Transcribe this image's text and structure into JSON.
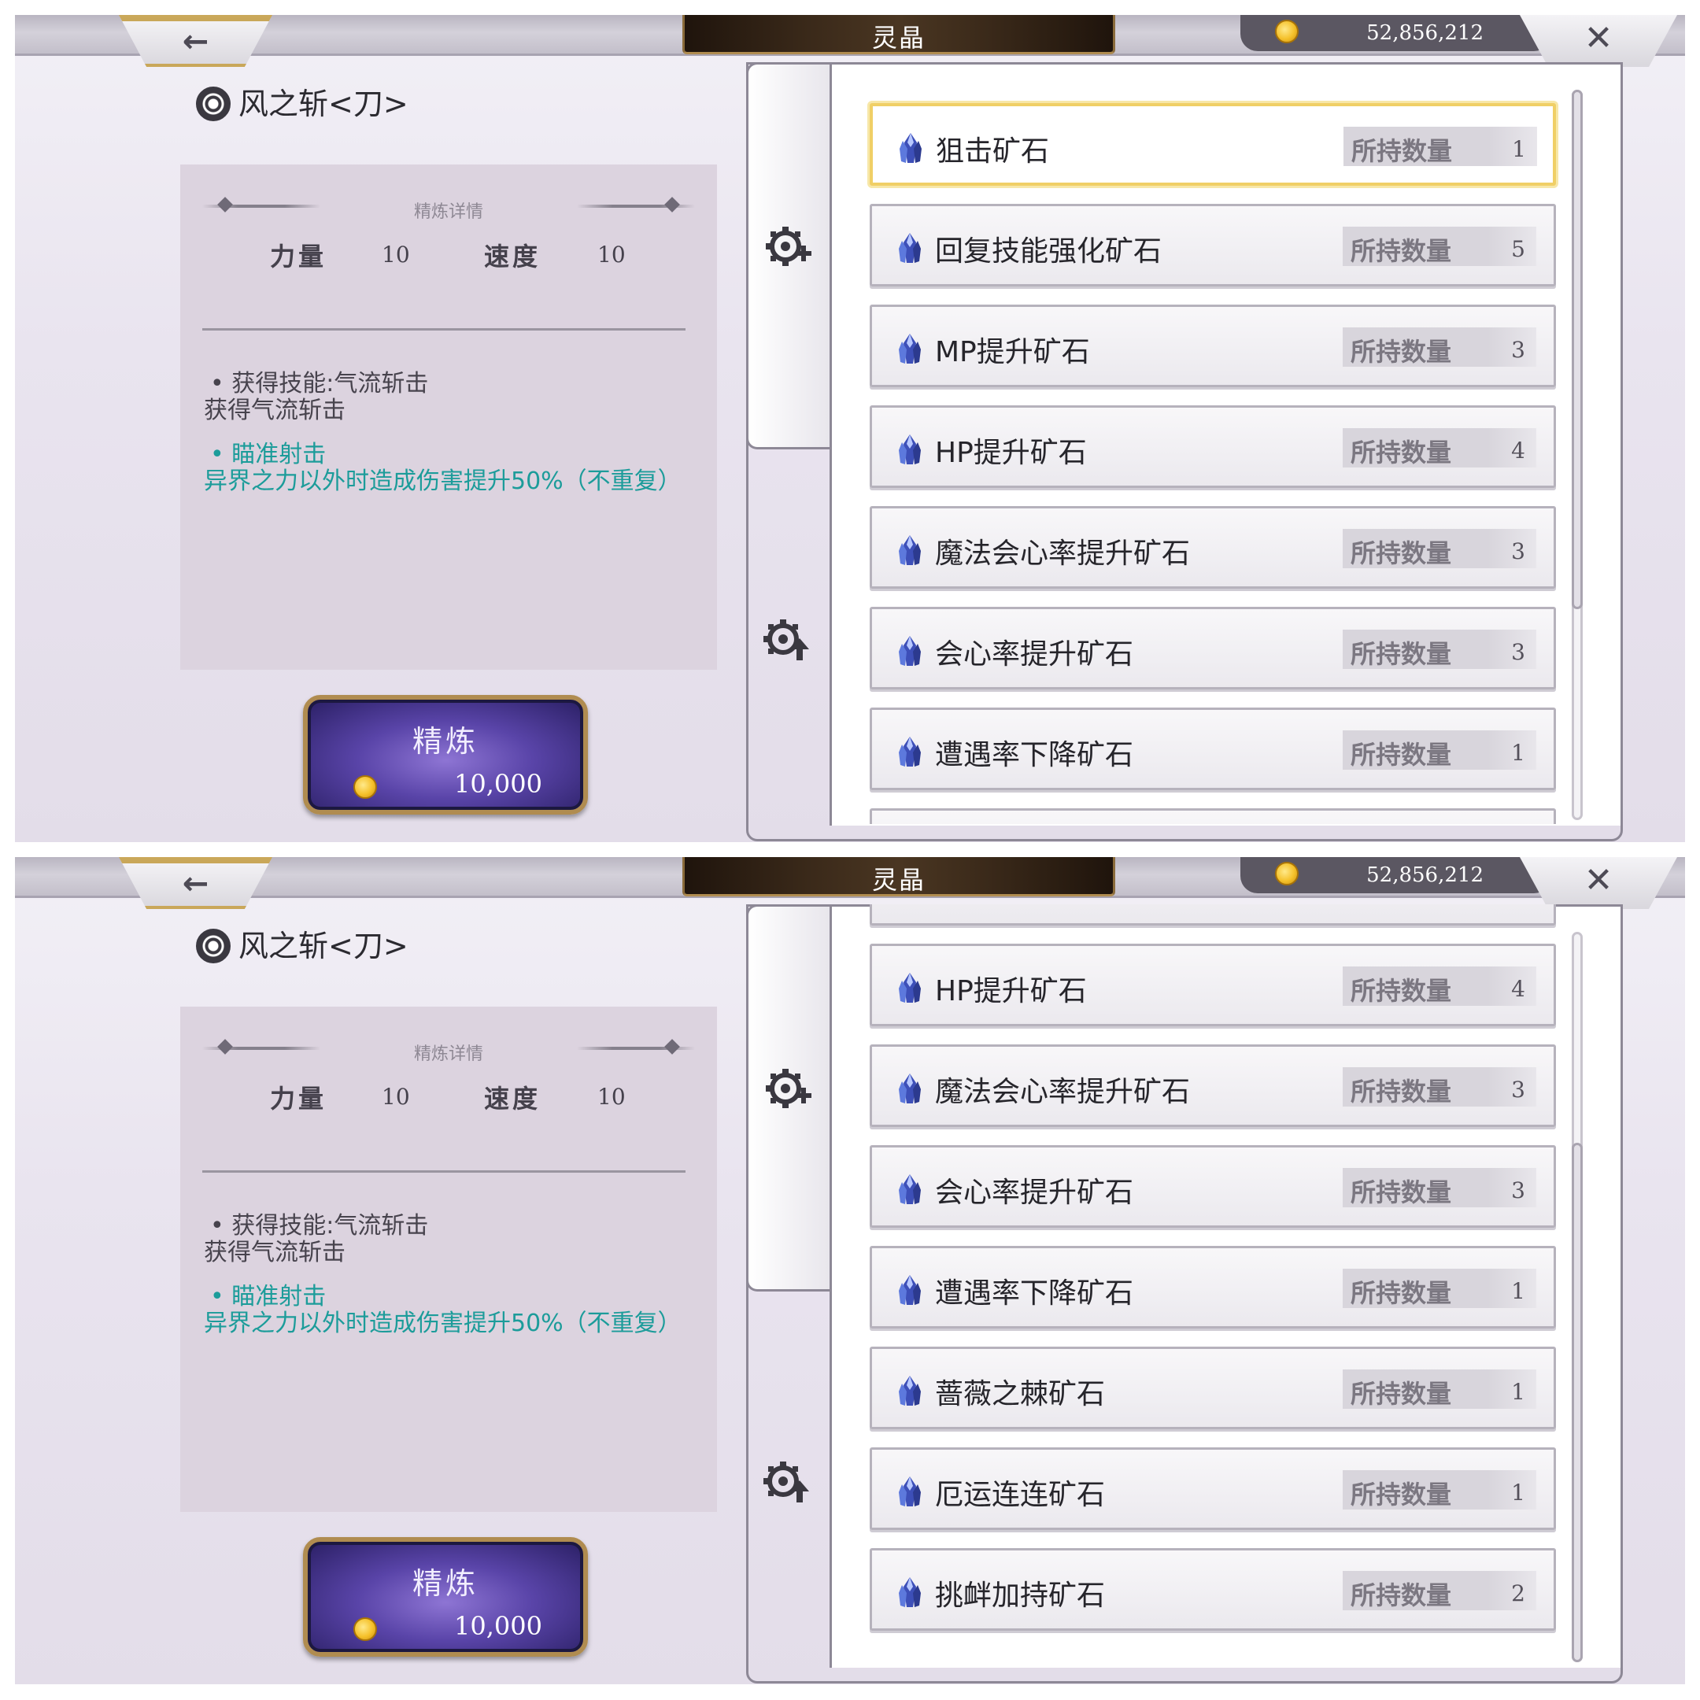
{
  "screens": [
    {
      "title": "灵晶",
      "currency": "52,856,212",
      "weapon_name": "风之斩<刀>",
      "detail": {
        "header": "精炼详情",
        "stats": [
          {
            "label": "力量",
            "value": "10"
          },
          {
            "label": "速度",
            "value": "10"
          }
        ],
        "effects": [
          {
            "title": "• 获得技能:气流斩击",
            "desc": "获得气流斩击"
          },
          {
            "title": "• 瞄准射击",
            "desc": "异界之力以外时造成伤害提升50%（不重复）"
          }
        ]
      },
      "refine": {
        "label": "精炼",
        "cost": "10,000"
      },
      "qty_label": "所持数量",
      "ores": [
        {
          "name": "狙击矿石",
          "qty": "1"
        },
        {
          "name": "回复技能强化矿石",
          "qty": "5"
        },
        {
          "name": "MP提升矿石",
          "qty": "3"
        },
        {
          "name": "HP提升矿石",
          "qty": "4"
        },
        {
          "name": "魔法会心率提升矿石",
          "qty": "3"
        },
        {
          "name": "会心率提升矿石",
          "qty": "3"
        },
        {
          "name": "遭遇率下降矿石",
          "qty": "1"
        }
      ],
      "selected_index": 0,
      "scroll_position": 0.0
    },
    {
      "title": "灵晶",
      "currency": "52,856,212",
      "weapon_name": "风之斩<刀>",
      "detail": {
        "header": "精炼详情",
        "stats": [
          {
            "label": "力量",
            "value": "10"
          },
          {
            "label": "速度",
            "value": "10"
          }
        ],
        "effects": [
          {
            "title": "• 获得技能:气流斩击",
            "desc": "获得气流斩击"
          },
          {
            "title": "• 瞄准射击",
            "desc": "异界之力以外时造成伤害提升50%（不重复）"
          }
        ]
      },
      "refine": {
        "label": "精炼",
        "cost": "10,000"
      },
      "qty_label": "所持数量",
      "ores": [
        {
          "name": "HP提升矿石",
          "qty": "4"
        },
        {
          "name": "魔法会心率提升矿石",
          "qty": "3"
        },
        {
          "name": "会心率提升矿石",
          "qty": "3"
        },
        {
          "name": "遭遇率下降矿石",
          "qty": "1"
        },
        {
          "name": "蔷薇之棘矿石",
          "qty": "1"
        },
        {
          "name": "厄运连连矿石",
          "qty": "1"
        },
        {
          "name": "挑衅加持矿石",
          "qty": "2"
        }
      ],
      "selected_index": -1,
      "scroll_position": 1.0
    }
  ],
  "icons": {
    "back": "back-arrow-icon",
    "close": "close-icon",
    "coin": "gold-coin-icon",
    "gear": "gear-icon",
    "ore": "blue-crystal-ore-icon",
    "tab_add": "gear-add-icon",
    "tab_upgrade": "gear-upgrade-icon"
  },
  "colors": {
    "effect_highlight": "#1c9c9a",
    "selected_border": "#f0cf66",
    "button_purple": "#5944a8",
    "title_plate": "#3b2a1a"
  }
}
